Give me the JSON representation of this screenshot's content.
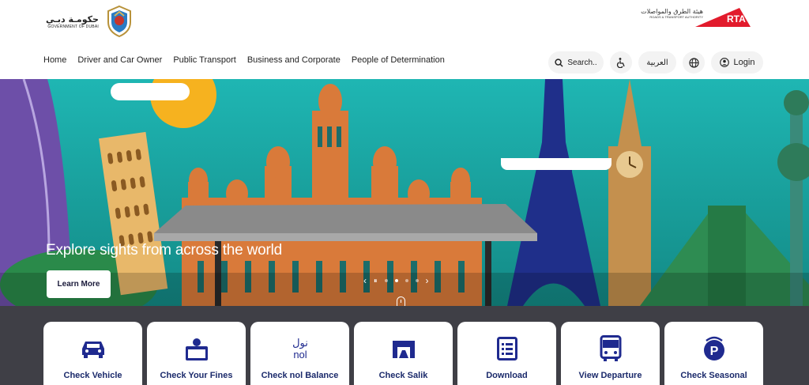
{
  "header": {
    "gov_logo": {
      "arabic": "حكومـة دبـي",
      "english": "GOVERNMENT OF DUBAI"
    },
    "rta_logo": {
      "arabic": "هيئة الطرق والمواصلات",
      "english": "ROADS & TRANSPORT AUTHORITY",
      "mark": "RTA"
    },
    "nav": [
      {
        "label": "Home"
      },
      {
        "label": "Driver and Car Owner"
      },
      {
        "label": "Public Transport"
      },
      {
        "label": "Business and Corporate"
      },
      {
        "label": "People of Determination"
      }
    ],
    "tools": {
      "search_label": "Search..",
      "language_label": "العربية",
      "login_label": "Login"
    }
  },
  "hero": {
    "caption": "Explore sights from across the world",
    "button_label": "Learn More",
    "controls": {
      "prev": "‹",
      "pause": "⏸",
      "next": "›"
    },
    "slide_count": 4,
    "active_slide": 2
  },
  "services": [
    {
      "label": "Check Vehicle",
      "icon": "car-icon"
    },
    {
      "label": "Check Your Fines",
      "icon": "fines-icon"
    },
    {
      "label": "Check nol Balance",
      "icon": "nol-card-icon"
    },
    {
      "label": "Check Salik",
      "icon": "salik-gate-icon"
    },
    {
      "label": "Download",
      "icon": "document-list-icon"
    },
    {
      "label": "View Departure",
      "icon": "bus-icon"
    },
    {
      "label": "Check Seasonal",
      "icon": "parking-icon"
    }
  ],
  "colors": {
    "service_text": "#1b2a6b",
    "service_icon": "#1f2a8f",
    "rta_red": "#e21b2c",
    "sky": "#1bb7b4",
    "bottom_bar": "#3f3f46"
  }
}
